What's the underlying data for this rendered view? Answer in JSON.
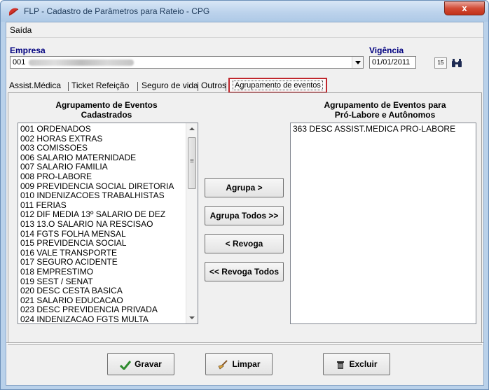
{
  "window": {
    "title": "FLP - Cadastro de Parâmetros para Rateio - CPG",
    "close_label": "x"
  },
  "menu": {
    "saida": "Saída"
  },
  "empresa": {
    "label": "Empresa",
    "code": "001"
  },
  "vigencia": {
    "label": "Vigência",
    "value": "01/01/2011",
    "cal_label": "15"
  },
  "tabs": {
    "assist": "Assist.Médica",
    "ticket": "Ticket Refeição",
    "seguro": "Seguro de vida",
    "outros": "Outros",
    "agrupamento": "Agrupamento de eventos"
  },
  "left_list": {
    "title_line1": "Agrupamento de Eventos",
    "title_line2": "Cadastrados",
    "items": [
      "001  ORDENADOS",
      "002  HORAS EXTRAS",
      "003  COMISSOES",
      "006  SALARIO MATERNIDADE",
      "007  SALARIO FAMILIA",
      "008  PRO-LABORE",
      "009  PREVIDENCIA SOCIAL DIRETORIA",
      "010  INDENIZACOES TRABALHISTAS",
      "011  FERIAS",
      "012  DIF MEDIA 13º SALARIO DE DEZ",
      "013  13.O SALARIO NA RESCISAO",
      "014  FGTS FOLHA MENSAL",
      "015  PREVIDENCIA SOCIAL",
      "016  VALE TRANSPORTE",
      "017  SEGURO ACIDENTE",
      "018  EMPRESTIMO",
      "019  SEST / SENAT",
      "020  DESC CESTA BASICA",
      "021  SALARIO EDUCACAO",
      "023  DESC PREVIDENCIA PRIVADA",
      "024  INDENIZACAO FGTS MULTA"
    ]
  },
  "right_list": {
    "title_line1": "Agrupamento de Eventos para",
    "title_line2": "Pró-Labore e Autônomos",
    "items": [
      "363  DESC ASSIST.MEDICA PRO-LABORE"
    ]
  },
  "actions": {
    "agrupa": "Agrupa >",
    "agrupa_todos": "Agrupa Todos >>",
    "revoga": "< Revoga",
    "revoga_todos": "<< Revoga Todos"
  },
  "footer": {
    "gravar": "Gravar",
    "limpar": "Limpar",
    "excluir": "Excluir"
  }
}
